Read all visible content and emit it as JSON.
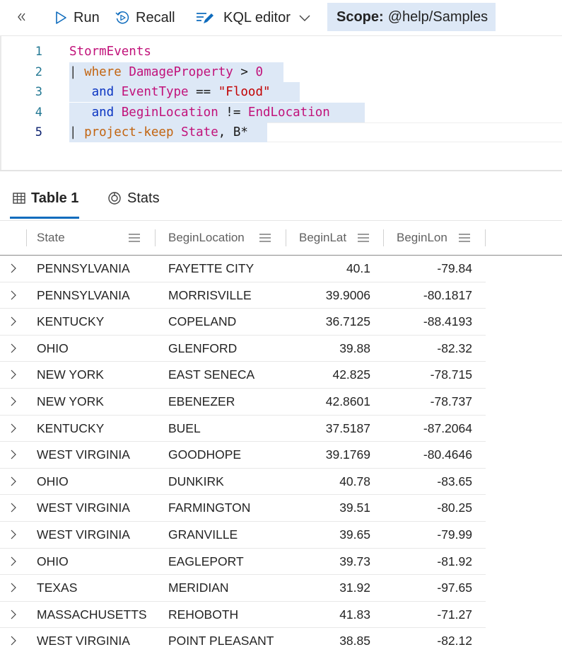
{
  "toolbar": {
    "run_label": "Run",
    "recall_label": "Recall",
    "kql_label": "KQL editor",
    "scope_label": "Scope:",
    "scope_value": "@help/Samples"
  },
  "editor": {
    "lines": [
      {
        "number": "1",
        "text": "StormEvents"
      },
      {
        "number": "2",
        "text": "| where DamageProperty > 0"
      },
      {
        "number": "3",
        "text": "    and EventType == \"Flood\""
      },
      {
        "number": "4",
        "text": "    and BeginLocation != EndLocation"
      },
      {
        "number": "5",
        "text": "| project-keep State, B*"
      }
    ]
  },
  "tabs": {
    "table_label": "Table 1",
    "stats_label": "Stats"
  },
  "grid": {
    "columns": [
      "State",
      "BeginLocation",
      "BeginLat",
      "BeginLon"
    ],
    "rows": [
      {
        "state": "PENNSYLVANIA",
        "location": "FAYETTE CITY",
        "lat": "40.1",
        "lon": "-79.84"
      },
      {
        "state": "PENNSYLVANIA",
        "location": "MORRISVILLE",
        "lat": "39.9006",
        "lon": "-80.1817"
      },
      {
        "state": "KENTUCKY",
        "location": "COPELAND",
        "lat": "36.7125",
        "lon": "-88.4193"
      },
      {
        "state": "OHIO",
        "location": "GLENFORD",
        "lat": "39.88",
        "lon": "-82.32"
      },
      {
        "state": "NEW YORK",
        "location": "EAST SENECA",
        "lat": "42.825",
        "lon": "-78.715"
      },
      {
        "state": "NEW YORK",
        "location": "EBENEZER",
        "lat": "42.8601",
        "lon": "-78.737"
      },
      {
        "state": "KENTUCKY",
        "location": "BUEL",
        "lat": "37.5187",
        "lon": "-87.2064"
      },
      {
        "state": "WEST VIRGINIA",
        "location": "GOODHOPE",
        "lat": "39.1769",
        "lon": "-80.4646"
      },
      {
        "state": "OHIO",
        "location": "DUNKIRK",
        "lat": "40.78",
        "lon": "-83.65"
      },
      {
        "state": "WEST VIRGINIA",
        "location": "FARMINGTON",
        "lat": "39.51",
        "lon": "-80.25"
      },
      {
        "state": "WEST VIRGINIA",
        "location": "GRANVILLE",
        "lat": "39.65",
        "lon": "-79.99"
      },
      {
        "state": "OHIO",
        "location": "EAGLEPORT",
        "lat": "39.73",
        "lon": "-81.92"
      },
      {
        "state": "TEXAS",
        "location": "MERIDIAN",
        "lat": "31.92",
        "lon": "-97.65"
      },
      {
        "state": "MASSACHUSETTS",
        "location": "REHOBOTH",
        "lat": "41.83",
        "lon": "-71.27"
      },
      {
        "state": "WEST VIRGINIA",
        "location": "POINT PLEASANT",
        "lat": "38.85",
        "lon": "-82.12"
      }
    ]
  },
  "icons": {
    "collapse": "double-chevron-left-icon",
    "run": "play-icon",
    "recall": "recall-icon",
    "kql": "kql-editor-icon",
    "table": "table-icon",
    "stats": "stats-icon",
    "menu": "column-menu-icon",
    "expand": "chevron-right-icon"
  },
  "colors": {
    "accent": "#0f6cbd",
    "scope_bg": "#dde8f6"
  }
}
